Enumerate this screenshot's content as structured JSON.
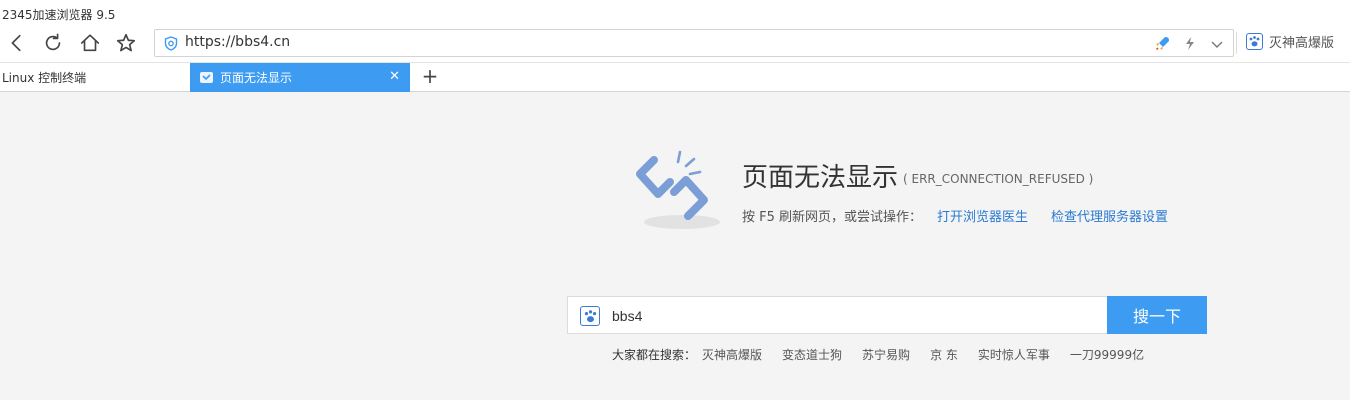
{
  "window": {
    "title": "2345加速浏览器 9.5"
  },
  "toolbar": {
    "back_icon": "chevron-left-icon",
    "reload_icon": "reload-icon",
    "home_icon": "home-icon",
    "favorite_icon": "star-icon",
    "url": "https://bbs4.cn",
    "quick_search_label": "灭神高爆版"
  },
  "tabs": [
    {
      "label": "Linux 控制终端",
      "active": false
    },
    {
      "label": "页面无法显示",
      "active": true
    }
  ],
  "new_tab_label": "+",
  "error": {
    "title": "页面无法显示",
    "code": "( ERR_CONNECTION_REFUSED )",
    "hint": "按 F5 刷新网页，或尝试操作：",
    "links": [
      "打开浏览器医生",
      "检查代理服务器设置"
    ]
  },
  "search": {
    "value": "bbs4",
    "button_label": "搜一下",
    "hot_label": "大家都在搜索：",
    "hot_items": [
      "灭神高爆版",
      "变态道士狗",
      "苏宁易购",
      "京 东",
      "实时惊人军事",
      "一刀99999亿"
    ]
  },
  "colors": {
    "accent": "#3d9bf2",
    "link": "#2a7ad2",
    "background": "#f4f4f4"
  }
}
